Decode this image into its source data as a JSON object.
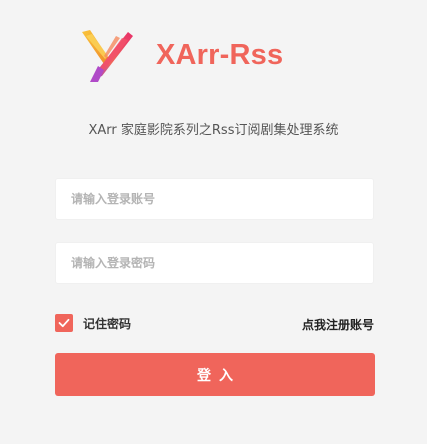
{
  "brand": {
    "logo_icon": "xarr-logo-icon",
    "title": "XArr-Rss",
    "accent_color": "#f0655b"
  },
  "subtitle": "XArr 家庭影院系列之Rss订阅剧集处理系统",
  "form": {
    "username": {
      "placeholder": "请输入登录账号",
      "value": ""
    },
    "password": {
      "placeholder": "请输入登录密码",
      "value": ""
    },
    "remember": {
      "label": "记住密码",
      "checked": true,
      "icon": "checkmark-icon"
    },
    "register_link": "点我注册账号",
    "submit_label": "登入"
  }
}
